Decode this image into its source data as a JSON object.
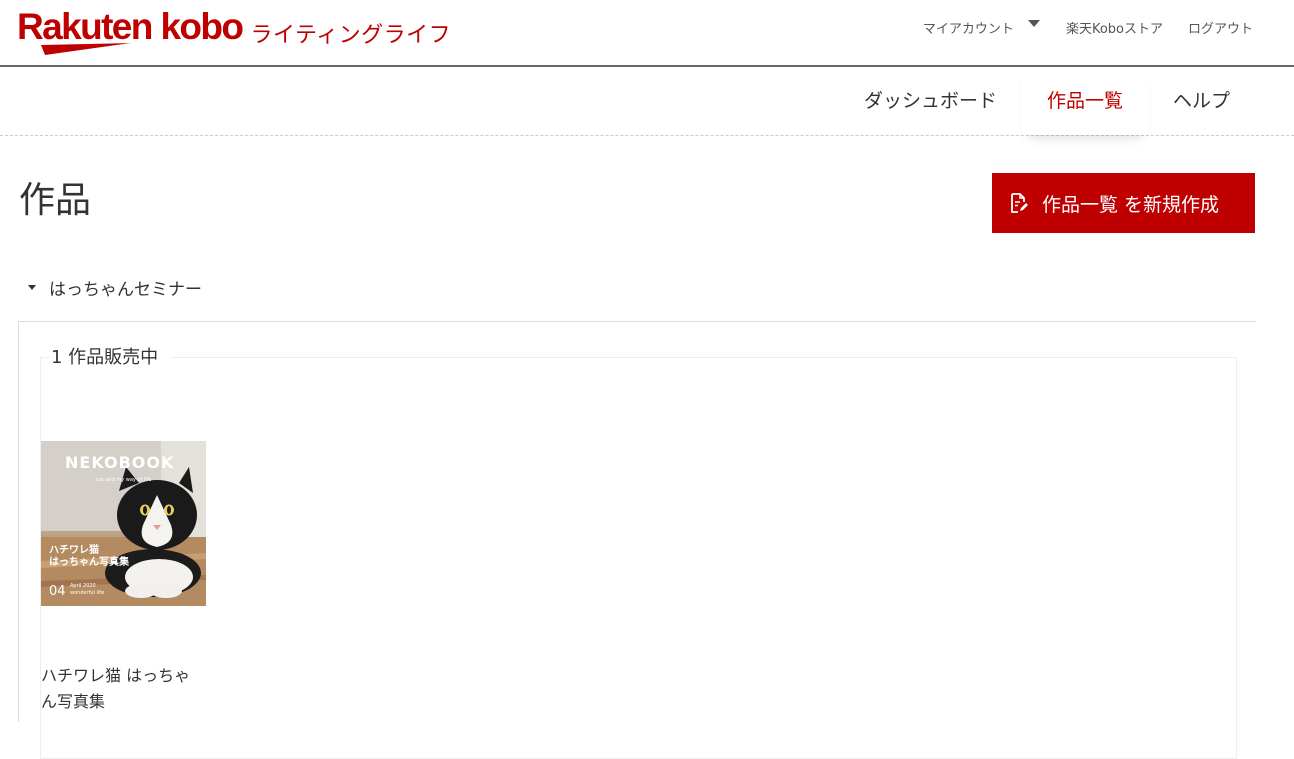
{
  "header": {
    "logo_text": "Rakuten kobo",
    "logo_sub": "ライティングライフ",
    "nav": {
      "my_account": "マイアカウント",
      "store": "楽天Koboストア",
      "logout": "ログアウト"
    }
  },
  "main_nav": {
    "tabs": [
      "ダッシュボード",
      "作品一覧",
      "ヘルプ"
    ],
    "active_index": 1
  },
  "page": {
    "title": "作品",
    "new_button": "作品一覧 を新規作成",
    "series_name": "はっちゃんセミナー",
    "count_label": "1 作品販売中"
  },
  "books": [
    {
      "title": "ハチワレ猫 はっちゃん写真集",
      "cover": {
        "headline": "NEKOBOOK",
        "tagline": "cat and my way of life",
        "title_line1": "ハチワレ猫",
        "title_line2": "はっちゃん写真集",
        "issue": "04",
        "date": "April 2020",
        "sub": "wonderful life"
      }
    }
  ],
  "colors": {
    "brand": "#bf0000",
    "button_bg": "#bf0000"
  }
}
